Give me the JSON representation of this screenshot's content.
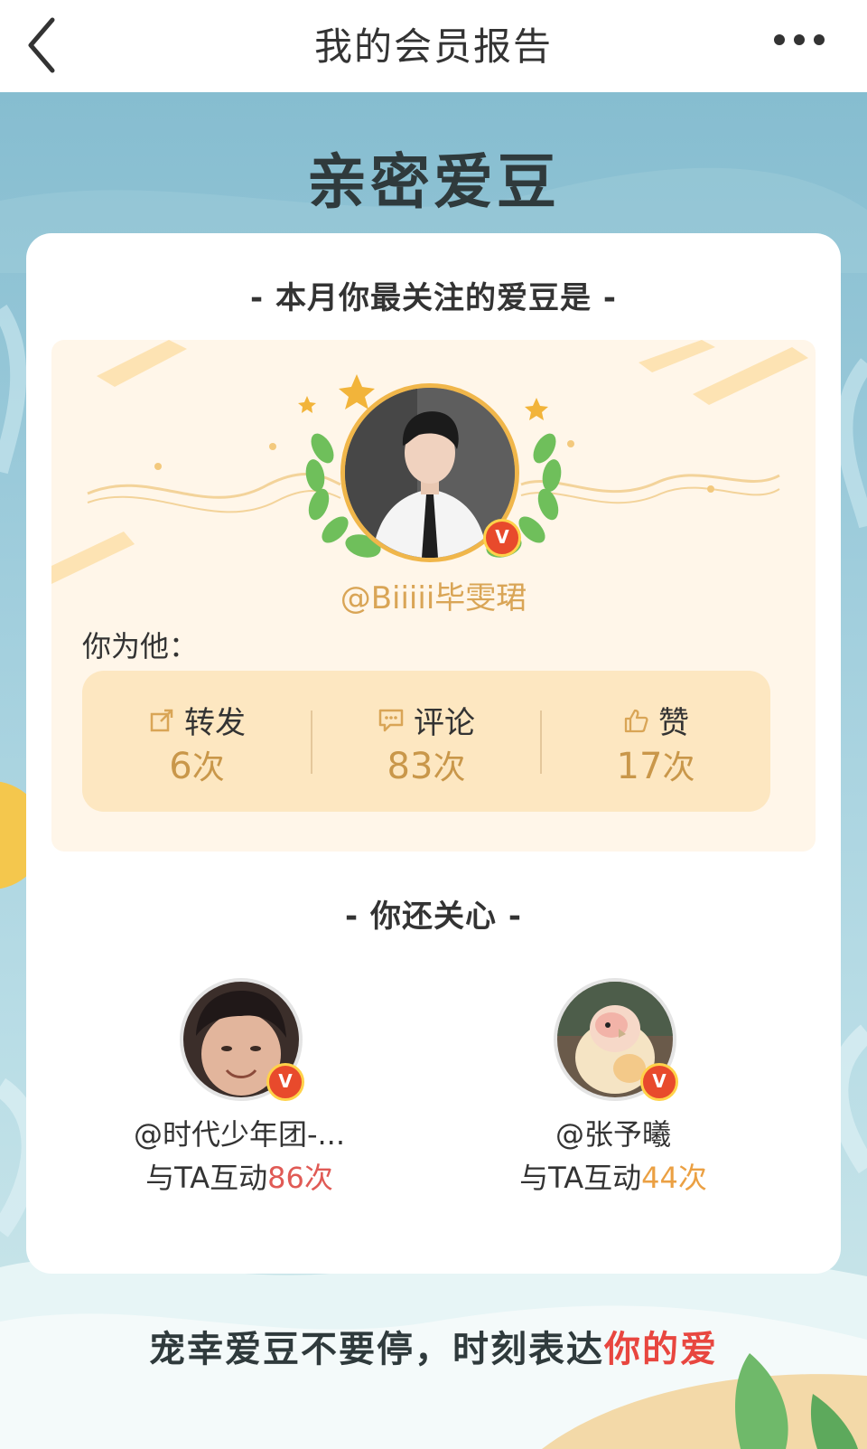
{
  "topbar": {
    "title": "我的会员报告",
    "back_icon": "chevron-left-icon",
    "more_icon": "ellipsis-horizontal-icon"
  },
  "section": {
    "title": "亲密爱豆"
  },
  "top_idol": {
    "heading": "- 本月你最关注的爱豆是 -",
    "handle": "@Biiiii毕雯珺",
    "verified": true,
    "you_for_him": "你为他：",
    "stats": [
      {
        "icon": "share-icon",
        "label": "转发",
        "count": "6",
        "unit": "次"
      },
      {
        "icon": "comment-icon",
        "label": "评论",
        "count": "83",
        "unit": "次"
      },
      {
        "icon": "thumbs-up-icon",
        "label": "赞",
        "count": "17",
        "unit": "次"
      }
    ]
  },
  "also_care": {
    "heading": "- 你还关心 -",
    "friends": [
      {
        "handle": "@时代少年团-...",
        "interact_prefix": "与TA互动",
        "count": "86次",
        "count_color": "#e05a55",
        "verified": true
      },
      {
        "handle": "@张予曦",
        "interact_prefix": "与TA互动",
        "count": "44次",
        "count_color": "#eba043",
        "verified": true
      }
    ]
  },
  "slogan": {
    "part1": "宠幸爱豆不要停，时刻表达",
    "highlight": "你的爱"
  },
  "colors": {
    "accent_gold": "#c9974a",
    "highlight_red": "#e8463f",
    "background_teal": "#86bdd0"
  }
}
